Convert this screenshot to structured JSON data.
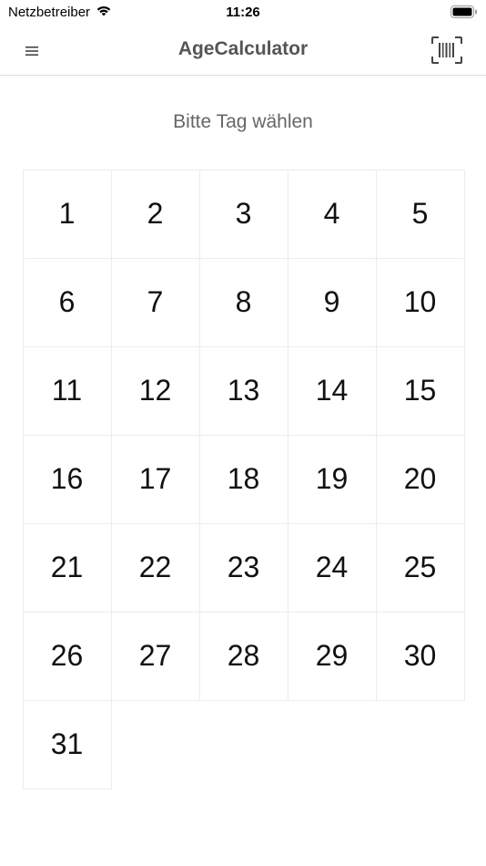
{
  "status_bar": {
    "carrier": "Netzbetreiber",
    "time": "11:26"
  },
  "nav": {
    "title": "AgeCalculator",
    "left_icon": "menu-icon",
    "right_icon": "barcode-scan-icon"
  },
  "prompt": "Bitte Tag wählen",
  "days": [
    "1",
    "2",
    "3",
    "4",
    "5",
    "6",
    "7",
    "8",
    "9",
    "10",
    "11",
    "12",
    "13",
    "14",
    "15",
    "16",
    "17",
    "18",
    "19",
    "20",
    "21",
    "22",
    "23",
    "24",
    "25",
    "26",
    "27",
    "28",
    "29",
    "30",
    "31"
  ],
  "colors": {
    "title": "#555555",
    "prompt": "#666666",
    "grid_border": "#ececec"
  }
}
